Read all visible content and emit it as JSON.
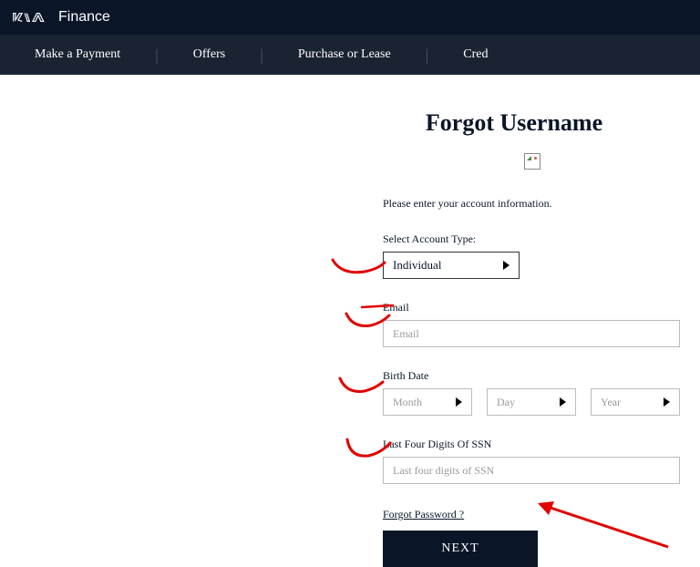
{
  "header": {
    "brand_text": "Finance"
  },
  "nav": {
    "items": [
      "Make a Payment",
      "Offers",
      "Purchase or Lease",
      "Cred"
    ]
  },
  "page": {
    "title": "Forgot Username",
    "intro": "Please enter your account information.",
    "account_type_label": "Select Account Type:",
    "account_type_value": "Individual",
    "email_label": "Email",
    "email_placeholder": "Email",
    "birth_label": "Birth Date",
    "month_placeholder": "Month",
    "day_placeholder": "Day",
    "year_placeholder": "Year",
    "ssn_label": "Last Four Digits Of SSN",
    "ssn_placeholder": "Last four digits of SSN",
    "forgot_link": "Forgot Password ?",
    "next_button": "NEXT"
  }
}
